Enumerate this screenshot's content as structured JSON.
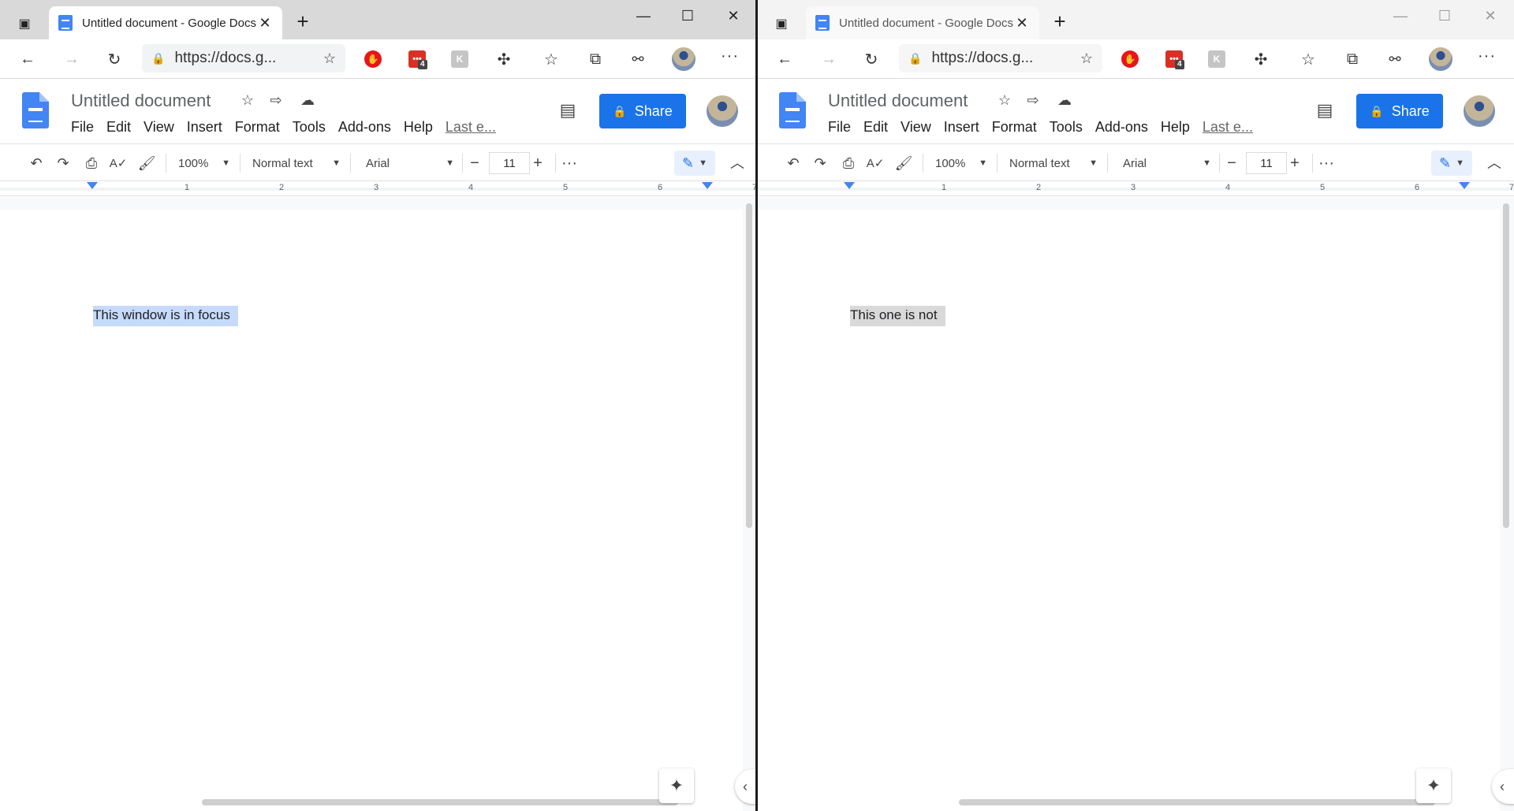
{
  "windows": [
    {
      "tab_title": "Untitled document - Google Docs",
      "url": "https://docs.g...",
      "extension_badge": "4",
      "doc_title": "Untitled document",
      "menu": [
        "File",
        "Edit",
        "View",
        "Insert",
        "Format",
        "Tools",
        "Add-ons",
        "Help"
      ],
      "last_edit": "Last e...",
      "share_label": "Share",
      "zoom": "100%",
      "style": "Normal text",
      "font": "Arial",
      "font_size": "11",
      "ruler_numbers": [
        "1",
        "2",
        "3",
        "4",
        "5",
        "6",
        "7"
      ],
      "body_text": "This window is in focus",
      "focused": true
    },
    {
      "tab_title": "Untitled document - Google Docs",
      "url": "https://docs.g...",
      "extension_badge": "4",
      "doc_title": "Untitled document",
      "menu": [
        "File",
        "Edit",
        "View",
        "Insert",
        "Format",
        "Tools",
        "Add-ons",
        "Help"
      ],
      "last_edit": "Last e...",
      "share_label": "Share",
      "zoom": "100%",
      "style": "Normal text",
      "font": "Arial",
      "font_size": "11",
      "ruler_numbers": [
        "1",
        "2",
        "3",
        "4",
        "5",
        "6",
        "7"
      ],
      "body_text": "This one is not",
      "focused": false
    }
  ],
  "colors": {
    "accent": "#1a73e8",
    "focus_highlight": "#c6dafc",
    "unfocus_highlight": "#d9d9d9"
  }
}
